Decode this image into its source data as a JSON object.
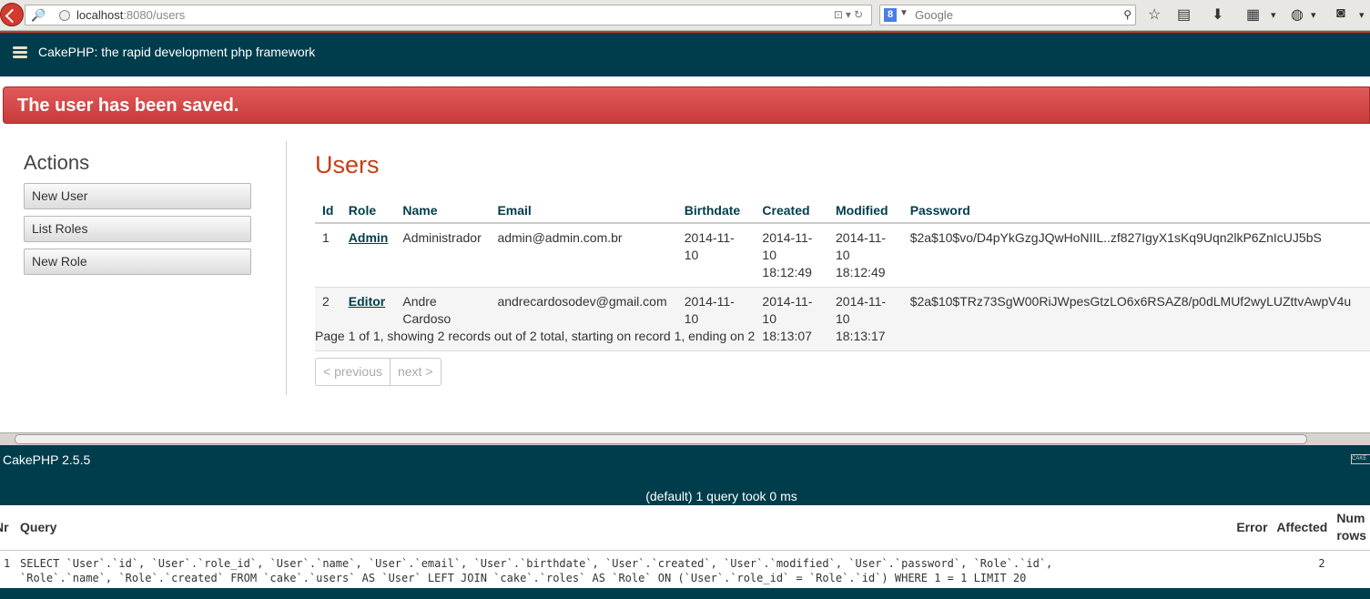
{
  "browser": {
    "url_host": "localhost",
    "url_port": ":8080",
    "url_path": "/users",
    "search_placeholder": "Google",
    "search_engine_letter": "8"
  },
  "header": {
    "title": "CakePHP: the rapid development php framework"
  },
  "flash": {
    "message": "The user has been saved."
  },
  "actions": {
    "heading": "Actions",
    "buttons": [
      "New User",
      "List Roles",
      "New Role"
    ]
  },
  "users": {
    "heading": "Users",
    "columns": [
      "Id",
      "Role",
      "Name",
      "Email",
      "Birthdate",
      "Created",
      "Modified",
      "Password"
    ],
    "rows": [
      {
        "id": "1",
        "role": "Admin",
        "name": "Administrador",
        "email": "admin@admin.com.br",
        "birthdate": "2014-11-10",
        "created": "2014-11-10 18:12:49",
        "modified": "2014-11-10 18:12:49",
        "password": "$2a$10$vo/D4pYkGzgJQwHoNIIL..zf827IgyX1sKq9Uqn2lkP6ZnIcUJ5bS"
      },
      {
        "id": "2",
        "role": "Editor",
        "name": "Andre Cardoso",
        "email": "andrecardosodev@gmail.com",
        "birthdate": "2014-11-10",
        "created": "2014-11-10 18:13:07",
        "modified": "2014-11-10 18:13:17",
        "password": "$2a$10$TRz73SgW00RiJWpesGtzLO6x6RSAZ8/p0dLMUf2wyLUZttvAwpV4u"
      }
    ],
    "paging": "Page 1 of 1, showing 2 records out of 2 total, starting on record 1, ending on 2",
    "prev": "< previous",
    "next": "next >"
  },
  "footer": {
    "version": "CakePHP 2.5.5",
    "powered_badge": "CAKE"
  },
  "sql_log": {
    "caption": "(default) 1 query took 0 ms",
    "headers": {
      "nr": "Nr",
      "query": "Query",
      "error": "Error",
      "affected": "Affected",
      "num_rows": "Num rows"
    },
    "rows": [
      {
        "nr": "1",
        "query_line1": "SELECT `User`.`id`, `User`.`role_id`, `User`.`name`, `User`.`email`, `User`.`birthdate`, `User`.`created`, `User`.`modified`, `User`.`password`, `Role`.`id`,",
        "query_line2": "`Role`.`name`, `Role`.`created` FROM `cake`.`users` AS `User` LEFT JOIN `cake`.`roles` AS `Role` ON (`User`.`role_id` = `Role`.`id`) WHERE 1 = 1 LIMIT 20",
        "error": "",
        "affected": "2",
        "num_rows": ""
      }
    ]
  },
  "colors": {
    "header_bg": "#003d4c",
    "flash_bg": "#c73a3a",
    "heading_red": "#c73e14",
    "link": "#003d4c"
  }
}
